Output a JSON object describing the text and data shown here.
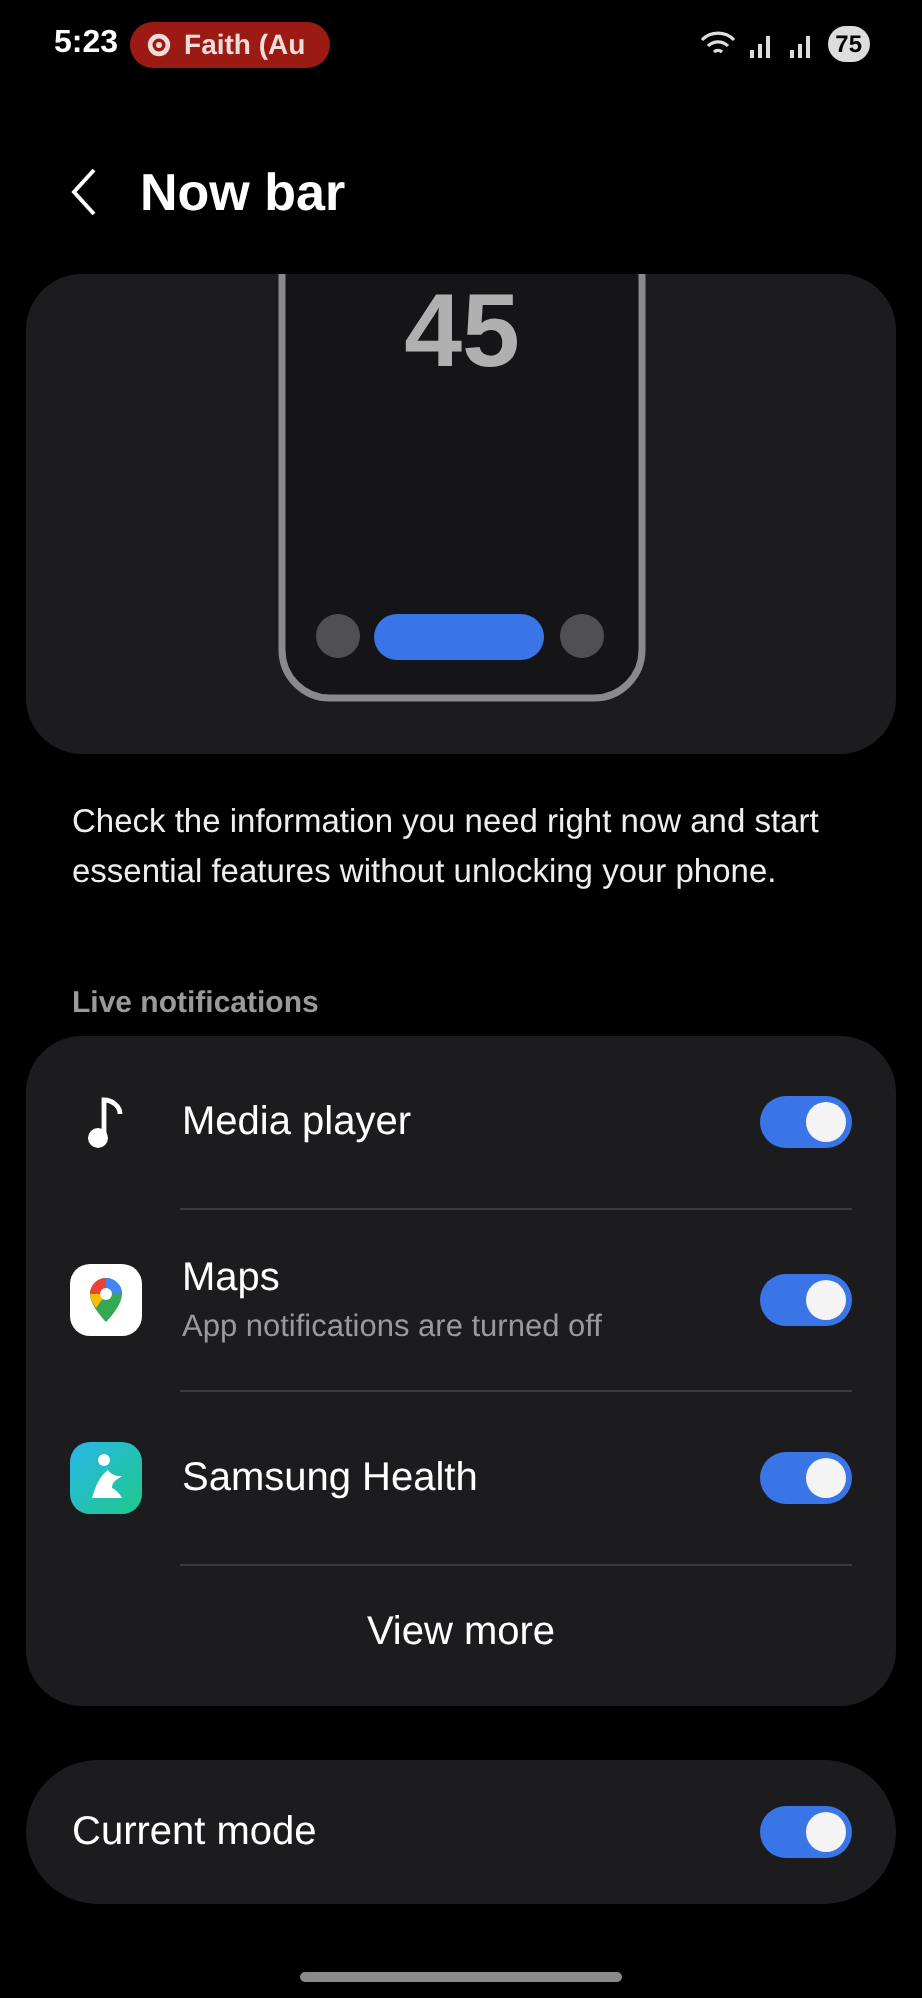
{
  "status_bar": {
    "time": "5:23",
    "media_chip": "Faith (Au",
    "battery": "75"
  },
  "header": {
    "title": "Now bar"
  },
  "preview": {
    "clock": "45"
  },
  "description": "Check the information you need right now and start essential features without unlocking your phone.",
  "section_label": "Live notifications",
  "apps": [
    {
      "kind": "music",
      "name": "Media player",
      "on": true
    },
    {
      "kind": "maps",
      "name": "Maps",
      "subtitle": "App notifications are turned off",
      "on": true
    },
    {
      "kind": "health",
      "name": "Samsung Health",
      "on": true
    }
  ],
  "view_more": "View more",
  "current_mode": {
    "label": "Current mode",
    "on": true
  }
}
